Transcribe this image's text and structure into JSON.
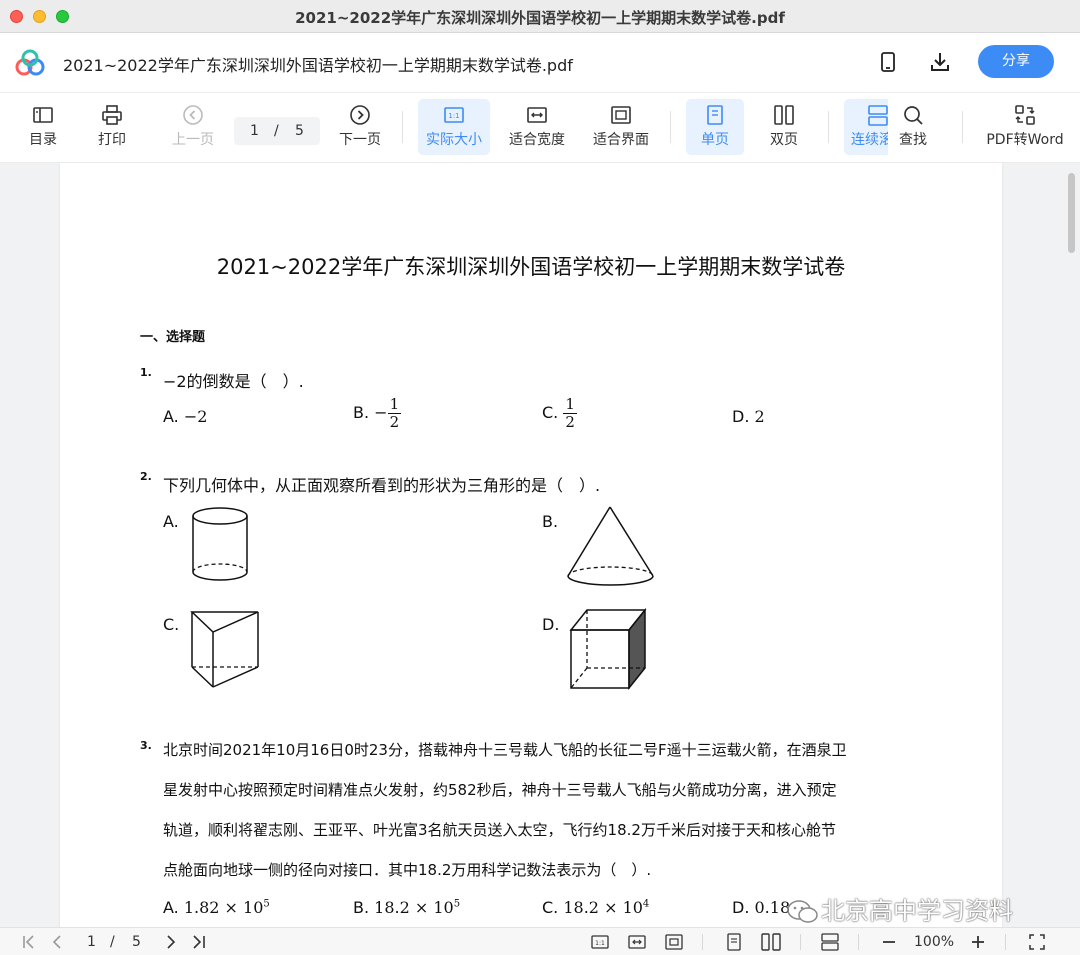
{
  "window": {
    "title": "2021~2022学年广东深圳深圳外国语学校初一上学期期末数学试卷.pdf"
  },
  "header": {
    "doc_title": "2021~2022学年广东深圳深圳外国语学校初一上学期期末数学试卷.pdf",
    "share_label": "分享",
    "brand_color": "#3d8cf5"
  },
  "toolbar": {
    "toc": "目录",
    "print": "打印",
    "prev": "上一页",
    "page_current": "1",
    "page_sep": "/",
    "page_total": "5",
    "next": "下一页",
    "actual_size": "实际大小",
    "fit_width": "适合宽度",
    "fit_page": "适合界面",
    "single": "单页",
    "double": "双页",
    "continuous": "连续滚",
    "find": "查找",
    "to_word": "PDF转Word"
  },
  "document": {
    "heading": "2021~2022学年广东深圳深圳外国语学校初一上学期期末数学试卷",
    "section": "一、选择题",
    "q1": {
      "num": "1.",
      "text": "−2的倒数是（　）.",
      "a_label": "A.",
      "a_val": "−2",
      "b_label": "B.",
      "b_sign": "−",
      "b_num": "1",
      "b_den": "2",
      "c_label": "C.",
      "c_num": "1",
      "c_den": "2",
      "d_label": "D.",
      "d_val": "2"
    },
    "q2": {
      "num": "2.",
      "text": "下列几何体中，从正面观察所看到的形状为三角形的是（　）.",
      "a_label": "A.",
      "b_label": "B.",
      "c_label": "C.",
      "d_label": "D."
    },
    "q3": {
      "num": "3.",
      "lines": [
        "北京时间2021年10月16日0时23分，搭载神舟十三号载人飞船的长征二号F遥十三运载火箭，在酒泉卫",
        "星发射中心按照预定时间精准点火发射，约582秒后，神舟十三号载人飞船与火箭成功分离，进入预定",
        "轨道，顺利将翟志刚、王亚平、叶光富3名航天员送入太空，飞行约18.2万千米后对接于天和核心舱节",
        "点舱面向地球一侧的径向对接口．其中18.2万用科学记数法表示为（　）."
      ],
      "a_label": "A.",
      "a_val": "1.82 × 10",
      "a_exp": "5",
      "b_label": "B.",
      "b_val": "18.2 × 10",
      "b_exp": "5",
      "c_label": "C.",
      "c_val": "18.2 × 10",
      "c_exp": "4",
      "d_label": "D.",
      "d_val": "0.18"
    },
    "watermark": "北京高中学习资料"
  },
  "statusbar": {
    "page_current": "1",
    "page_sep": "/",
    "page_total": "5",
    "zoom": "100%"
  }
}
